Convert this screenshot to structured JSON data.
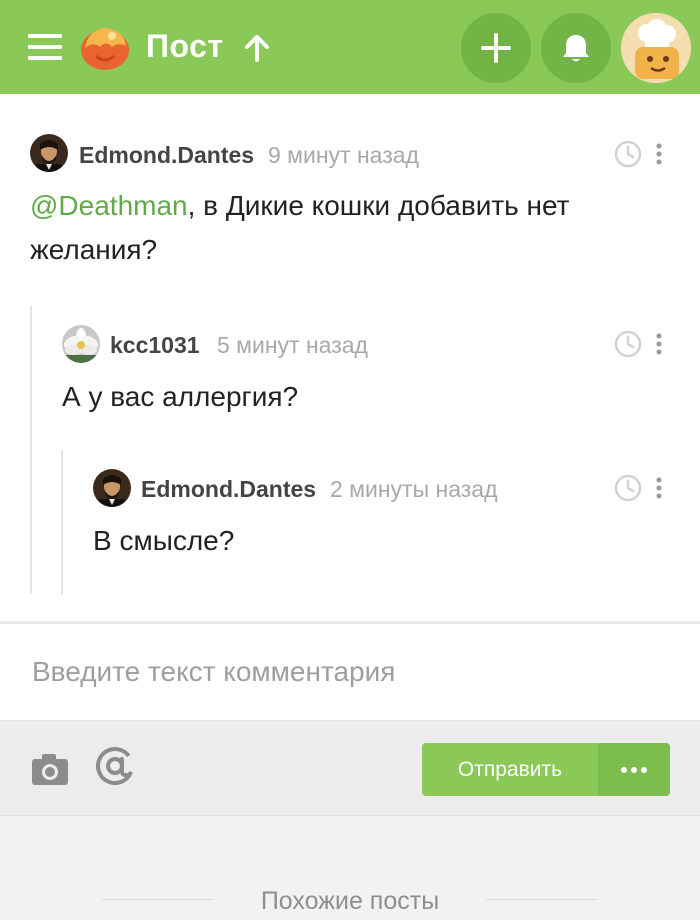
{
  "header": {
    "title": "Пост",
    "icons": {
      "menu": "hamburger-menu-icon",
      "logo": "cupcake-logo-icon",
      "scroll_up": "arrow-up-icon",
      "add": "plus-icon",
      "notifications": "bell-icon",
      "profile": "user-avatar"
    },
    "colors": {
      "bar": "#8ac858",
      "button": "#72b446"
    }
  },
  "comments": [
    {
      "author": "Edmond.Dantes",
      "time": "9 минут назад",
      "mention": "@Deathman",
      "text": ", в Дикие кошки добавить нет желания?",
      "level": 0
    },
    {
      "author": "kcc1031",
      "time": "5 минут назад",
      "text": "А у вас аллергия?",
      "level": 1
    },
    {
      "author": "Edmond.Dantes",
      "time": "2 минуты назад",
      "text": "В смысле?",
      "level": 2
    }
  ],
  "composer": {
    "placeholder": "Введите текст комментария",
    "send_label": "Отправить",
    "icons": {
      "attach_image": "camera-icon",
      "mention": "at-sign-icon",
      "more": "more-dots-icon"
    },
    "colors": {
      "send": "#8ac858",
      "mention_text": "#62a94a"
    }
  },
  "similar_posts": {
    "title": "Похожие посты"
  }
}
